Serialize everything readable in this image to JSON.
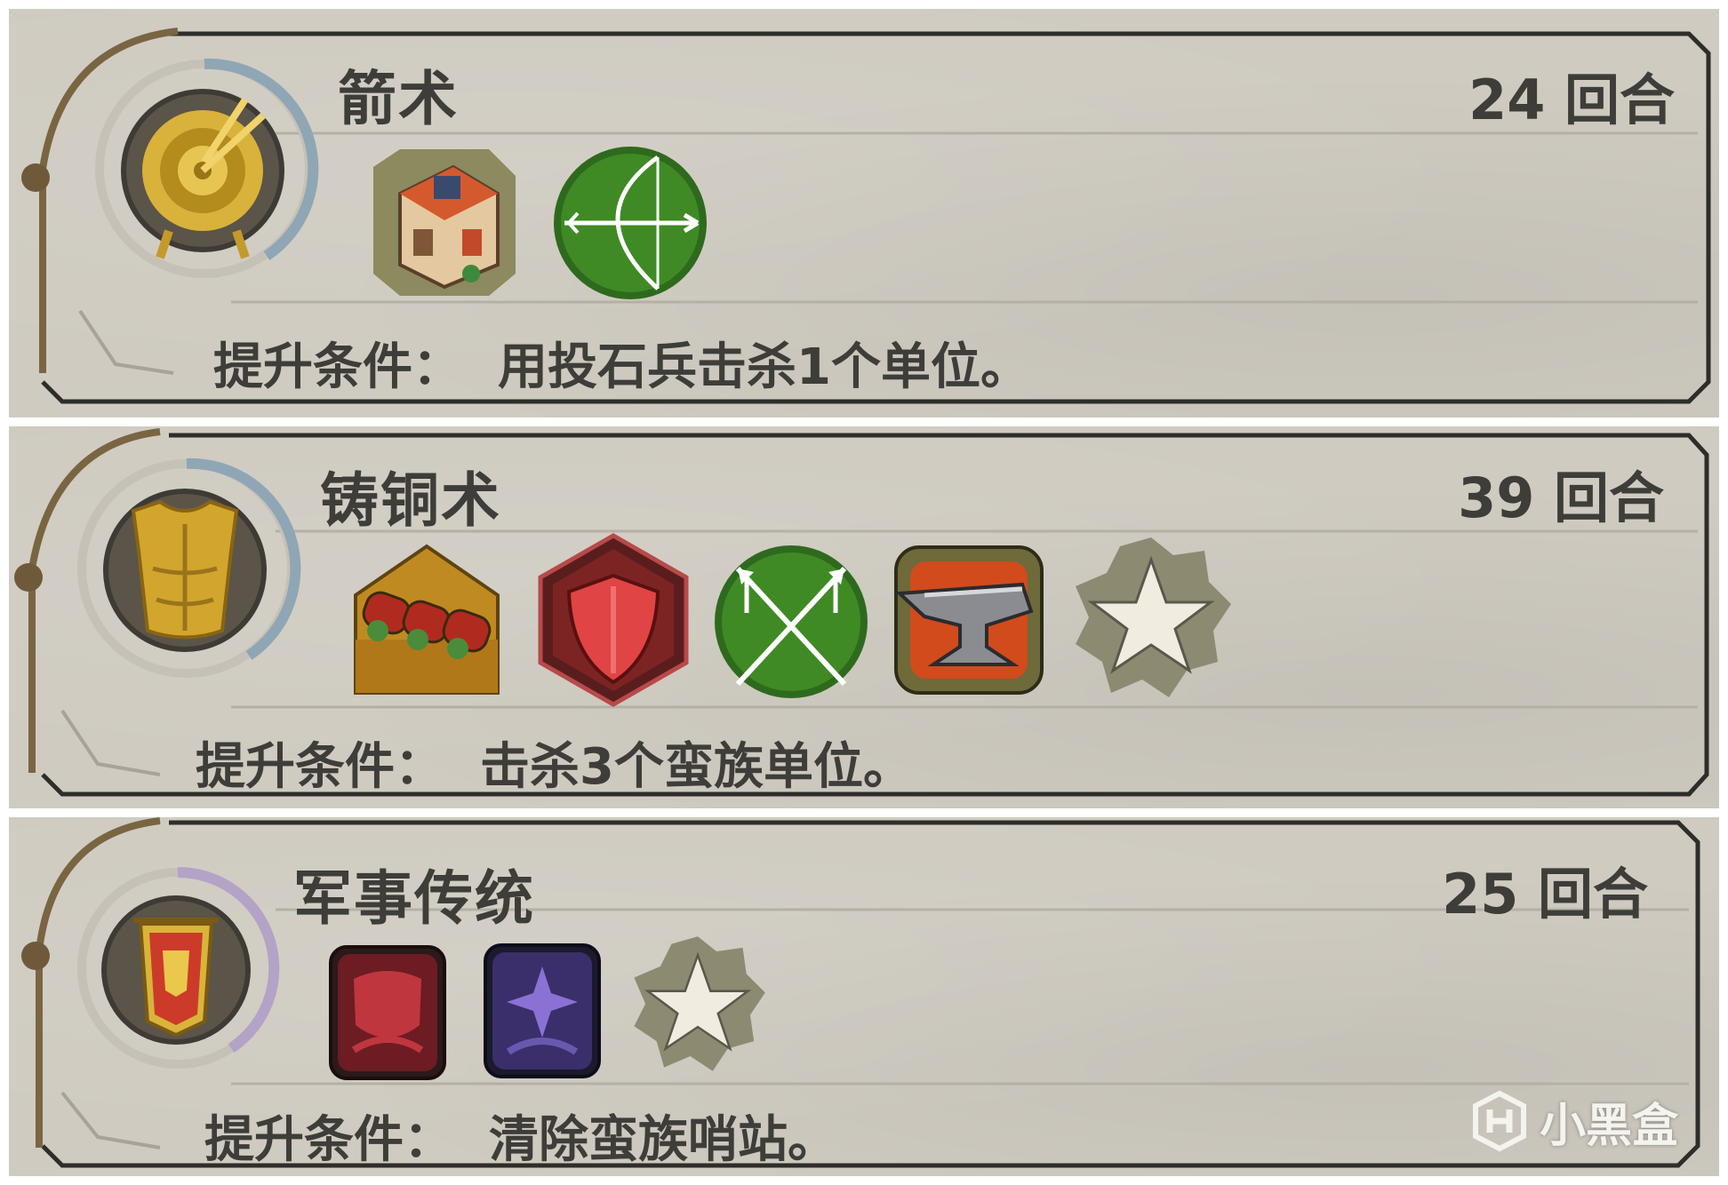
{
  "techs": [
    {
      "name": "箭术",
      "turns": "24 回合",
      "condition_label": "提升条件：",
      "condition_text": "用投石兵击杀1个单位。",
      "main_icon": "archery-target-icon",
      "progress": 0.3,
      "progress_color": "#8fa6b5",
      "unlocks": [
        "archery-range-building-icon",
        "archer-bow-icon"
      ]
    },
    {
      "name": "铸铜术",
      "turns": "39 回合",
      "condition_label": "提升条件：",
      "condition_text": "击杀3个蛮族单位。",
      "main_icon": "bronze-armor-icon",
      "progress": 0.3,
      "progress_color": "#8fa6b5",
      "unlocks": [
        "copper-resource-icon",
        "defense-shield-icon",
        "crossed-spears-icon",
        "anvil-icon",
        "star-bonus-icon"
      ]
    },
    {
      "name": "军事传统",
      "turns": "25 回合",
      "condition_label": "提升条件：",
      "condition_text": "清除蛮族哨站。",
      "main_icon": "military-banner-icon",
      "progress": 0.3,
      "progress_color": "#b3a3c6",
      "unlocks": [
        "red-shield-policy-icon",
        "purple-wildcard-policy-icon",
        "star-bonus-icon"
      ]
    }
  ],
  "watermark": {
    "text": "小黑盒",
    "icon": "heybox-logo-icon"
  }
}
